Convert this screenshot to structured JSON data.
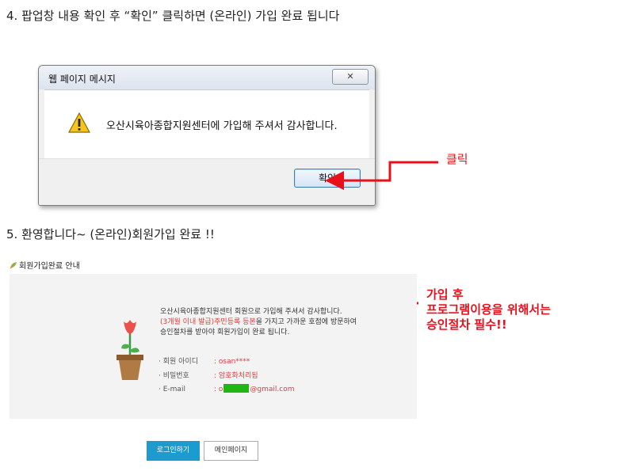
{
  "step4": {
    "heading": "4. 팝업창 내용 확인 후 “확인” 클릭하면 (온라인) 가입 완료 됩니다"
  },
  "dialog": {
    "title": "웹 페이지 메시지",
    "message": "오산시육아종합지원센터에 가입해 주셔서 감사합니다.",
    "ok_label": "확인",
    "close_glyph": "✕",
    "icon": "warning-icon"
  },
  "annotations": {
    "click_label": "클릭",
    "note_lines": [
      "가입 후",
      "프로그램이용을 위해서는",
      "승인절차 필수!!"
    ],
    "color": "#e8101b"
  },
  "step5": {
    "heading": "5. 환영합니다~ (온라인)회원가입 완료 !!"
  },
  "signup_complete": {
    "section_title": "회원가입완료 안내",
    "line1": "오산시육아종합지원센터 회원으로 가입해 주셔서 감사합니다.",
    "line2_highlight": "(3개월 이내 발급)주민등록 등본",
    "line2_rest": "을 가지고 가까운 호점에 방문하여",
    "line3": "승인절차를 받아야 회원가입이 완료 됩니다.",
    "info": {
      "id_label": "· 회원 아이디",
      "id_value": ":  osan****",
      "pw_label": "· 비밀번호",
      "pw_value": ":  암호화처리됨",
      "email_label": "· E-mail",
      "email_prefix": ":  o",
      "email_suffix": "@gmail.com"
    },
    "login_button": "로그인하기",
    "main_button": "메인페이지",
    "accent": "#1d9bcf"
  }
}
